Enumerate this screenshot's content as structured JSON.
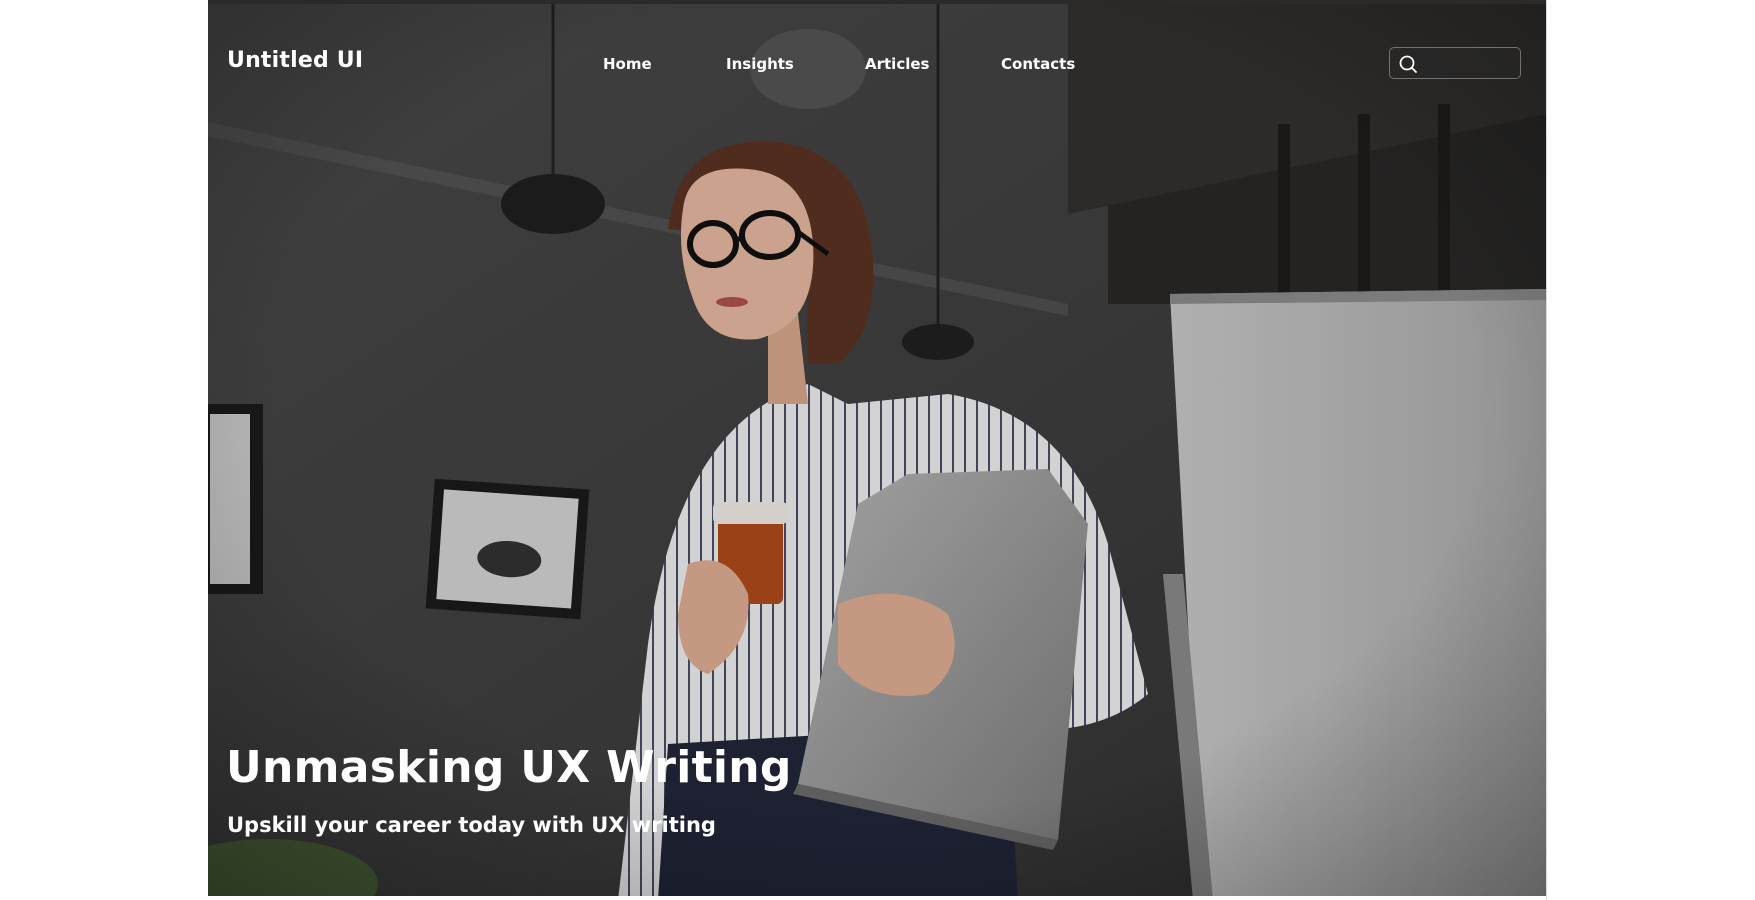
{
  "brand": {
    "name": "Untitled UI"
  },
  "nav": {
    "items": [
      {
        "label": "Home"
      },
      {
        "label": "Insights"
      },
      {
        "label": "Articles"
      },
      {
        "label": "Contacts"
      }
    ]
  },
  "search": {
    "value": "",
    "placeholder": "",
    "icon": "search-icon"
  },
  "hero": {
    "title": "Unmasking UX Writing",
    "subtitle": "Upskill your career today with UX writing"
  },
  "colors": {
    "text": "#ffffff",
    "background_dark": "#3a3939",
    "page": "#ffffff"
  }
}
